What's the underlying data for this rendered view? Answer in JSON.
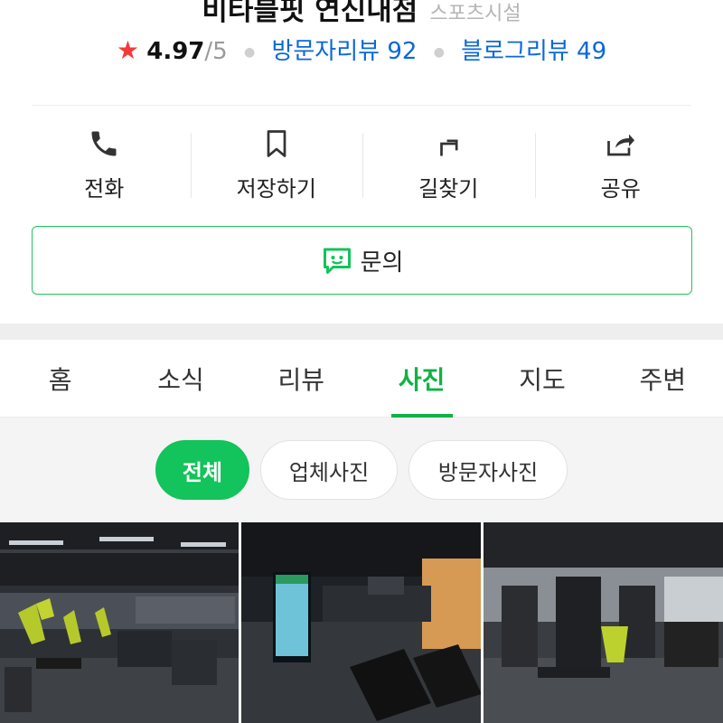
{
  "header": {
    "place_name": "비타블핏 연신내점",
    "category": "스포츠시설"
  },
  "rating": {
    "star_icon": "star-icon",
    "score": "4.97",
    "max": "/5",
    "visitor_reviews": "방문자리뷰 92",
    "blog_reviews": "블로그리뷰 49"
  },
  "actions": [
    {
      "label": "전화",
      "icon": "phone-icon"
    },
    {
      "label": "저장하기",
      "icon": "bookmark-icon"
    },
    {
      "label": "길찾기",
      "icon": "directions-icon"
    },
    {
      "label": "공유",
      "icon": "share-icon"
    }
  ],
  "inquiry": {
    "label": "문의",
    "icon": "talk-bubble-icon"
  },
  "tabs": [
    {
      "label": "홈",
      "active": false
    },
    {
      "label": "소식",
      "active": false
    },
    {
      "label": "리뷰",
      "active": false
    },
    {
      "label": "사진",
      "active": true
    },
    {
      "label": "지도",
      "active": false
    },
    {
      "label": "주변",
      "active": false
    }
  ],
  "filters": [
    {
      "label": "전체",
      "active": true
    },
    {
      "label": "업체사진",
      "active": false
    },
    {
      "label": "방문자사진",
      "active": false
    }
  ],
  "colors": {
    "brand_green": "#13c35b",
    "link_blue": "#0a68d8",
    "star_red": "#f33a3a"
  }
}
